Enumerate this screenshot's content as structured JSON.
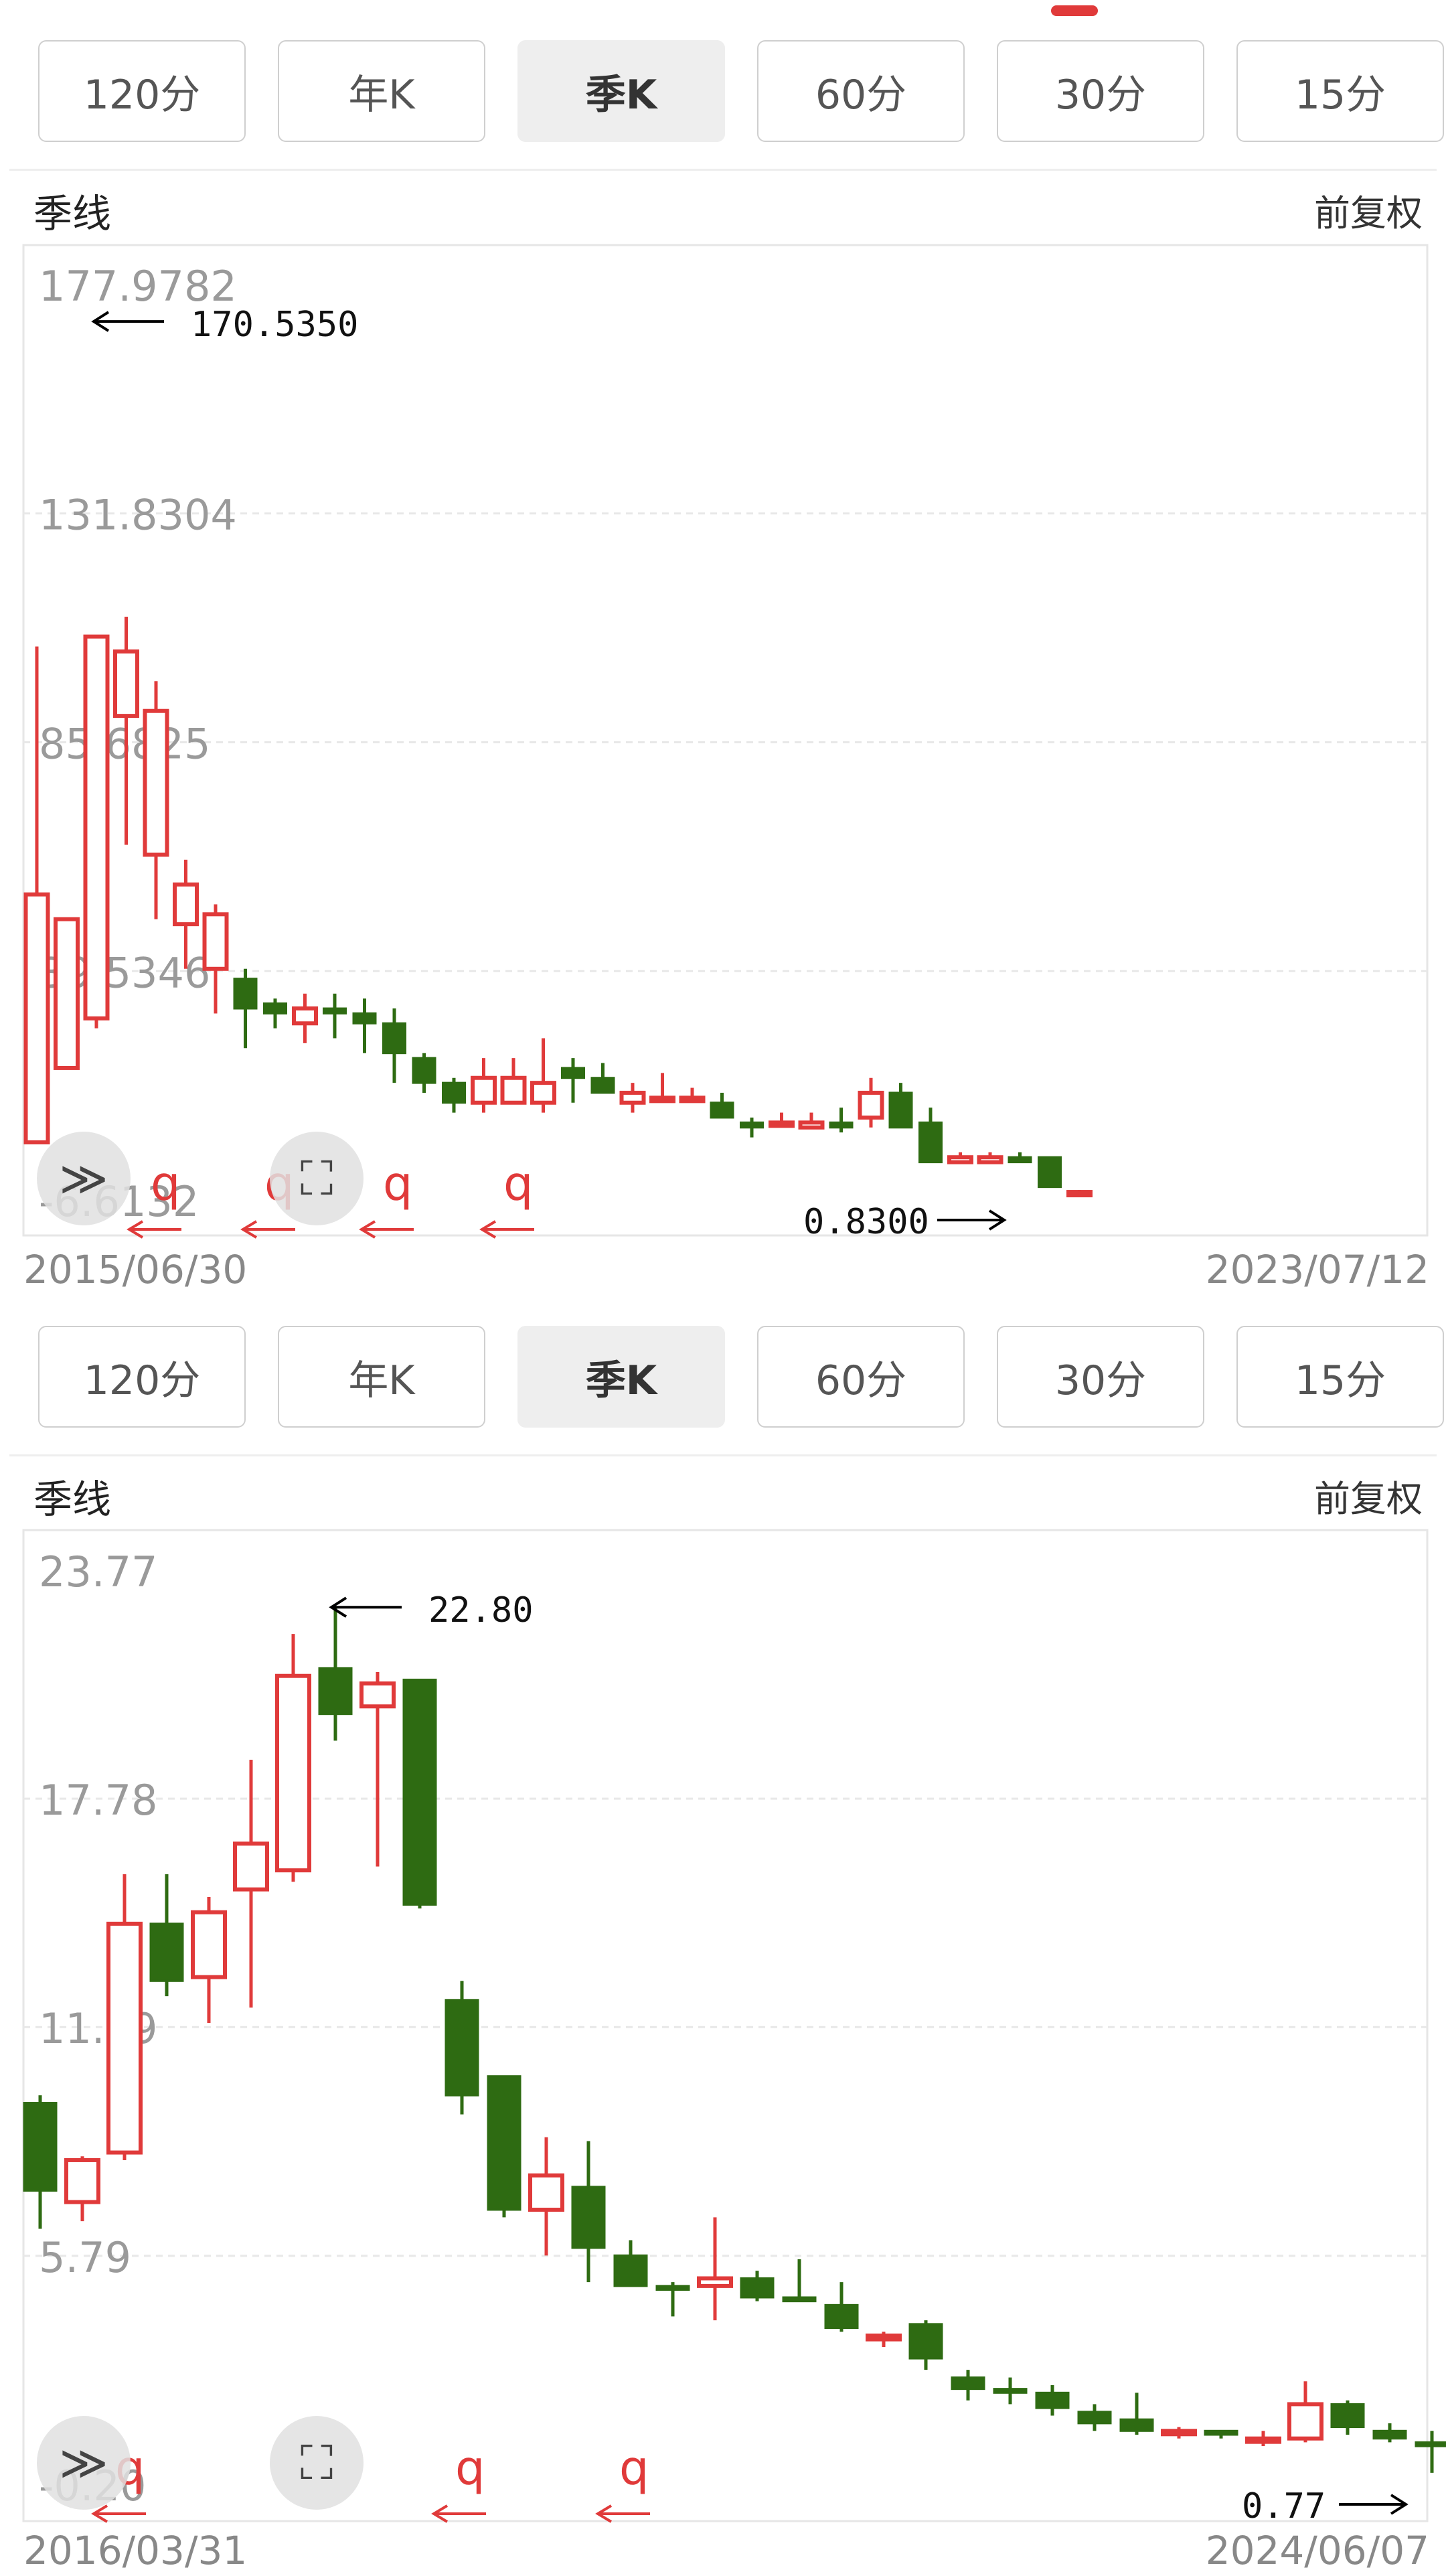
{
  "tabs": [
    "120分",
    "年K",
    "季K",
    "60分",
    "30分",
    "15分"
  ],
  "active_tab": 2,
  "panels": [
    {
      "title_left": "季线",
      "title_right": "前复权",
      "start_date": "2015/06/30",
      "end_date": "2023/07/12",
      "y_ticks": [
        "177.9782",
        "131.8304",
        "85.6825",
        "39.5346",
        "-6.6132"
      ],
      "high_label": "170.5350",
      "low_label": "0.8300",
      "annotation_q": "q"
    },
    {
      "title_left": "季线",
      "title_right": "前复权",
      "start_date": "2016/03/31",
      "end_date": "2024/06/07",
      "y_ticks": [
        "23.77",
        "17.78",
        "11.79",
        "5.79",
        "-0.20"
      ],
      "high_label": "22.80",
      "low_label": "0.77",
      "annotation_q": "q"
    }
  ],
  "chart_data": [
    {
      "type": "candlestick",
      "title": "季线",
      "x_range": [
        "2015/06/30",
        "2023/07/12"
      ],
      "ylim": [
        -6.6132,
        177.9782
      ],
      "y_ticks": [
        177.9782,
        131.8304,
        85.6825,
        39.5346,
        -6.6132
      ],
      "max_marked": 170.535,
      "min_marked": 0.83,
      "colors": {
        "up": "#e03a3a",
        "down": "#2e6b12"
      },
      "ohlc": [
        [
          5,
          105,
          5,
          55
        ],
        [
          20,
          30,
          20,
          50
        ],
        [
          30,
          107,
          28,
          107
        ],
        [
          91,
          111,
          65,
          104
        ],
        [
          63,
          98,
          50,
          92
        ],
        [
          49,
          62,
          40,
          57
        ],
        [
          40,
          53,
          31,
          51
        ],
        [
          38,
          40,
          24,
          32
        ],
        [
          33,
          34,
          28,
          31
        ],
        [
          29,
          35,
          25,
          32
        ],
        [
          32,
          35,
          26,
          31
        ],
        [
          31,
          34,
          23,
          29
        ],
        [
          29,
          32,
          17,
          23
        ],
        [
          22,
          23,
          15,
          17
        ],
        [
          17,
          18,
          11,
          13
        ],
        [
          13,
          22,
          11,
          18
        ],
        [
          13,
          22,
          13,
          18
        ],
        [
          13,
          26,
          11,
          17
        ],
        [
          20,
          22,
          13,
          18
        ],
        [
          18,
          21,
          15,
          15
        ],
        [
          13,
          17,
          11,
          15
        ],
        [
          14,
          19,
          13,
          14
        ],
        [
          14,
          16,
          14,
          14
        ],
        [
          13,
          15,
          10,
          10
        ],
        [
          9,
          10,
          6,
          8
        ],
        [
          9,
          11,
          8,
          9
        ],
        [
          8,
          11,
          8,
          9
        ],
        [
          9,
          12,
          7,
          8
        ],
        [
          10,
          18,
          8,
          15
        ],
        [
          15,
          17,
          8,
          8
        ],
        [
          9,
          12,
          1,
          1
        ],
        [
          1,
          3,
          0.83,
          2
        ],
        [
          1,
          3,
          0.83,
          2
        ],
        [
          2,
          3,
          1,
          1
        ],
        [
          2,
          1,
          -4,
          -4
        ],
        [
          -5,
          -4.6,
          -5.4,
          -5
        ]
      ]
    },
    {
      "type": "candlestick",
      "title": "季线",
      "x_range": [
        "2016/03/31",
        "2024/06/07"
      ],
      "ylim": [
        -0.2,
        23.77
      ],
      "y_ticks": [
        23.77,
        17.78,
        11.79,
        5.79,
        -0.2
      ],
      "max_marked": 22.8,
      "min_marked": 0.77,
      "colors": {
        "up": "#e03a3a",
        "down": "#2e6b12"
      },
      "ohlc": [
        [
          9.8,
          10.0,
          6.5,
          7.5
        ],
        [
          7.2,
          8.4,
          6.7,
          8.3
        ],
        [
          8.5,
          15.8,
          8.3,
          14.5
        ],
        [
          14.5,
          15.8,
          12.6,
          13.0
        ],
        [
          13.1,
          15.2,
          11.9,
          14.8
        ],
        [
          15.4,
          18.8,
          12.3,
          16.6
        ],
        [
          15.9,
          22.1,
          15.6,
          21.0
        ],
        [
          21.2,
          22.8,
          19.3,
          20.0
        ],
        [
          20.2,
          21.1,
          16.0,
          20.8
        ],
        [
          20.9,
          20.7,
          14.9,
          15.0
        ],
        [
          12.5,
          13.0,
          9.5,
          10.0
        ],
        [
          10.5,
          10.0,
          6.8,
          7.0
        ],
        [
          7.0,
          8.9,
          5.8,
          7.9
        ],
        [
          7.6,
          8.8,
          5.1,
          6.0
        ],
        [
          5.8,
          6.2,
          5.0,
          5.0
        ],
        [
          5.0,
          5.1,
          4.2,
          4.9
        ],
        [
          5.0,
          6.8,
          4.1,
          5.2
        ],
        [
          5.2,
          5.4,
          4.6,
          4.7
        ],
        [
          4.7,
          5.7,
          4.6,
          4.6
        ],
        [
          4.5,
          5.1,
          3.8,
          3.9
        ],
        [
          3.6,
          3.8,
          3.4,
          3.7
        ],
        [
          4.0,
          4.1,
          2.8,
          3.1
        ],
        [
          2.6,
          2.8,
          2.0,
          2.3
        ],
        [
          2.3,
          2.6,
          1.9,
          2.2
        ],
        [
          2.2,
          2.4,
          1.6,
          1.8
        ],
        [
          1.7,
          1.9,
          1.2,
          1.4
        ],
        [
          1.5,
          2.2,
          1.1,
          1.2
        ],
        [
          1.2,
          1.3,
          1.0,
          1.2
        ],
        [
          1.2,
          1.2,
          1.0,
          1.1
        ],
        [
          1.0,
          1.2,
          0.8,
          1.0
        ],
        [
          1.0,
          2.5,
          0.9,
          1.9
        ],
        [
          1.9,
          2.0,
          1.1,
          1.3
        ],
        [
          1.2,
          1.4,
          0.9,
          1.0
        ],
        [
          0.9,
          1.2,
          0.1,
          0.8
        ]
      ]
    }
  ]
}
